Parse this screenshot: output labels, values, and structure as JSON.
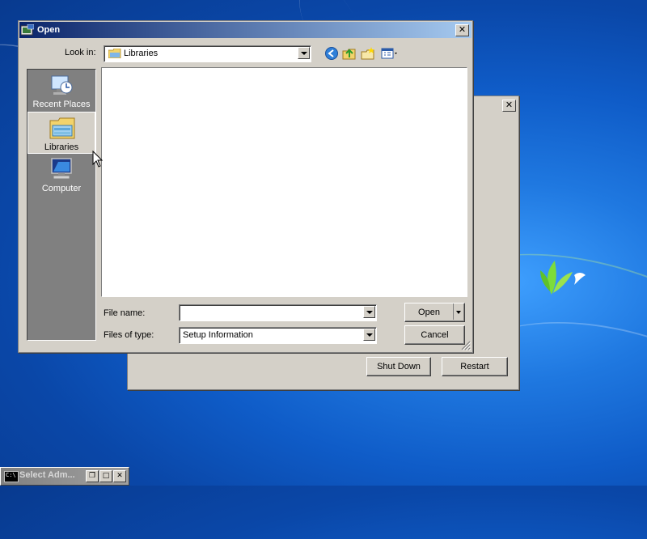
{
  "back_dialog": {
    "shutdown_label": "Shut Down",
    "restart_label": "Restart"
  },
  "open_dialog": {
    "title": "Open",
    "look_in_label": "Look in:",
    "look_in_value": "Libraries",
    "places": [
      {
        "label": "Recent Places",
        "icon": "recent-places-icon"
      },
      {
        "label": "Libraries",
        "icon": "libraries-icon",
        "selected": true
      },
      {
        "label": "Computer",
        "icon": "computer-icon"
      }
    ],
    "file_name_label": "File name:",
    "file_name_value": "",
    "files_of_type_label": "Files of type:",
    "files_of_type_value": "Setup Information",
    "open_label": "Open",
    "cancel_label": "Cancel",
    "toolbar_icons": [
      "back-icon",
      "up-folder-icon",
      "new-folder-icon",
      "view-menu-icon"
    ]
  },
  "minimized_window": {
    "title": "Select Adm..."
  },
  "colors": {
    "title_gradient_start": "#0a246a",
    "title_gradient_end": "#a6caf0",
    "dialog_face": "#d4d0c8",
    "places_bar": "#808080",
    "desktop": "#1f78e0"
  }
}
